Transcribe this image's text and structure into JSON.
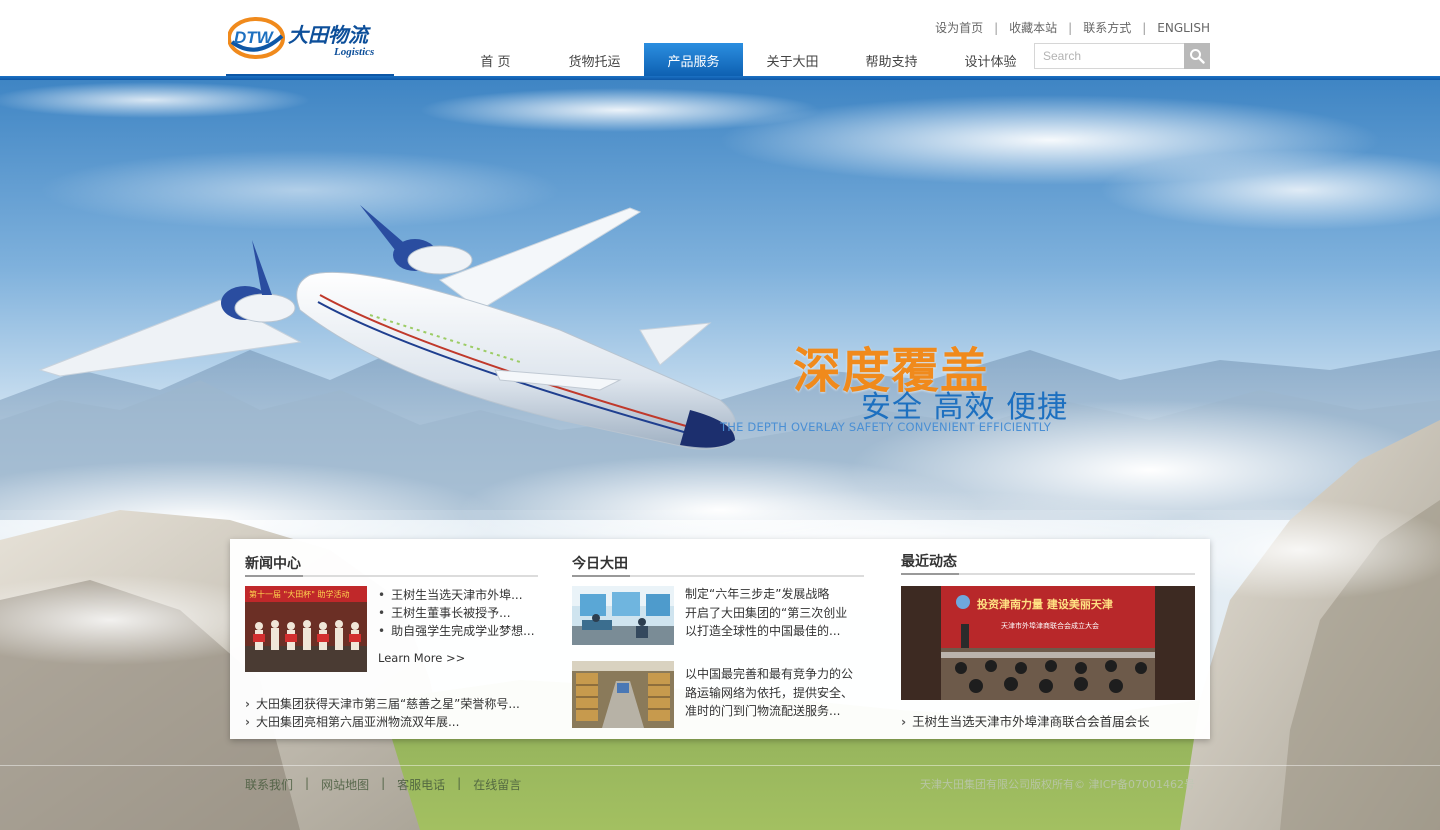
{
  "brand": {
    "logo_mark": "DTW",
    "logo_cn": "大田物流",
    "logo_en": "Logistics",
    "colors": {
      "primary_blue": "#0d57a6",
      "accent_orange": "#f08a1c",
      "nav_active": "#1c78d0"
    }
  },
  "top_links": [
    {
      "label": "设为首页"
    },
    {
      "label": "收藏本站"
    },
    {
      "label": "联系方式"
    },
    {
      "label": "ENGLISH"
    }
  ],
  "nav": {
    "items": [
      {
        "label": "首 页",
        "active": false
      },
      {
        "label": "货物托运",
        "active": false
      },
      {
        "label": "产品服务",
        "active": true
      },
      {
        "label": "关于大田",
        "active": false
      },
      {
        "label": "帮助支持",
        "active": false
      },
      {
        "label": "设计体验",
        "active": false
      }
    ]
  },
  "search": {
    "placeholder": "Search",
    "icon": "search-icon"
  },
  "banner": {
    "headline": "深度覆盖",
    "subline": "安全 高效 便捷",
    "english": "THE DEPTH OVERLAY SAFETY CONVENIENT EFFICIENTLY"
  },
  "news": {
    "title": "新闻中心",
    "bullets": [
      "王树生当选天津市外埠...",
      "王树生董事长被授予...",
      "助自强学生完成学业梦想..."
    ],
    "more": "Learn More >>",
    "links": [
      "大田集团获得天津市第三届“慈善之星”荣誉称号...",
      "大田集团亮相第六届亚洲物流双年展..."
    ]
  },
  "today": {
    "title": "今日大田",
    "item1": [
      "制定“六年三步走”发展战略",
      "开启了大田集团的“第三次创业",
      "以打造全球性的中国最佳的..."
    ],
    "item2": [
      "以中国最完善和最有竞争力的公",
      "路运输网络为依托，提供安全、",
      "准时的门到门物流配送服务..."
    ]
  },
  "recent": {
    "title": "最近动态",
    "photo_banner_text": "投资津南力量  建设美丽天津",
    "photo_subtitle": "天津市外埠津商联合会成立大会",
    "link": "王树生当选天津市外埠津商联合会首届会长"
  },
  "footer": {
    "links": [
      "联系我们",
      "网站地图",
      "客服电话",
      "在线留言"
    ],
    "copyright": "天津大田集团有限公司版权所有© 津ICP备07001462号"
  }
}
